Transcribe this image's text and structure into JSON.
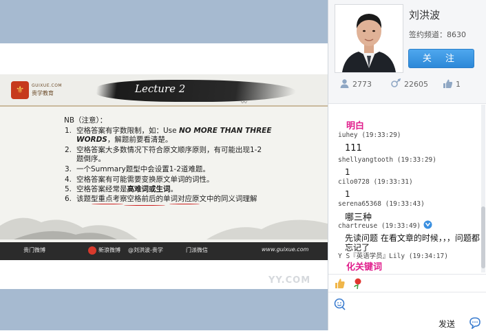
{
  "slide": {
    "lecture_title": "Lecture 2",
    "logo_en": "GUIXUE.COM",
    "logo_cn": "贵学教育",
    "note_head": "NB（注意）：",
    "points": [
      {
        "num": "1.",
        "pre": "空格答案有字数限制，如：Use ",
        "italic": "NO MORE THAN THREE",
        "line2_italic": "WORDS",
        "line2_rest": "，解题前要看清楚。"
      },
      {
        "num": "2.",
        "text": "空格答案大多数情况下符合原文顺序原则，有可能出现1-2",
        "line2": "题倒序。"
      },
      {
        "num": "3.",
        "text": "一个Summary题型中会设置1-2道难题。"
      },
      {
        "num": "4.",
        "text": "空格答案有可能需要变换原文单词的词性。"
      },
      {
        "num": "5.",
        "pre": "空格答案经常是",
        "bold": "高难词或生词",
        "post": "。"
      },
      {
        "num": "6.",
        "text": "该题型重点考察空格前后的单词对应原文中的同义词理解"
      }
    ],
    "footer": {
      "left": "贵门微博",
      "weibo": "新浪微博",
      "weibo_handle": "@刘洪波-贵学",
      "mid": "门派微信",
      "url": "www.guixue.com"
    },
    "watermark": "YY.COM"
  },
  "profile": {
    "name": "刘洪波",
    "channel": "签约频道：8630",
    "follow_label": "关 注",
    "stats": {
      "fans": "2773",
      "gifts": "22605",
      "likes": "1"
    }
  },
  "chat": [
    {
      "kind": "emph",
      "text": "明白"
    },
    {
      "kind": "user",
      "text": "iuhey (19:33:29)"
    },
    {
      "kind": "body_big",
      "text": "111"
    },
    {
      "kind": "user",
      "text": "shellyangtooth (19:33:29)"
    },
    {
      "kind": "body",
      "text": "1"
    },
    {
      "kind": "user",
      "text": "cilo0728 (19:33:31)"
    },
    {
      "kind": "body",
      "text": "1"
    },
    {
      "kind": "user",
      "text": "serena65368 (19:33:43)"
    },
    {
      "kind": "body_big",
      "text": "哪三种"
    },
    {
      "kind": "user",
      "text": "chartreuse (19:33:49)"
    },
    {
      "kind": "body",
      "text": "先读问题 在看文章的时候，，，问题都"
    },
    {
      "kind": "body",
      "text": "忘记了"
    },
    {
      "kind": "user",
      "text": "Y S『英语学员』Lily (19:34:17)"
    },
    {
      "kind": "emph",
      "text": "化关键词"
    }
  ],
  "input": {
    "send_label": "发送"
  },
  "colors": {
    "accent_blue": "#2d88d8",
    "chat_emphasis": "#e01e8c",
    "frame": "#a6bad0"
  }
}
